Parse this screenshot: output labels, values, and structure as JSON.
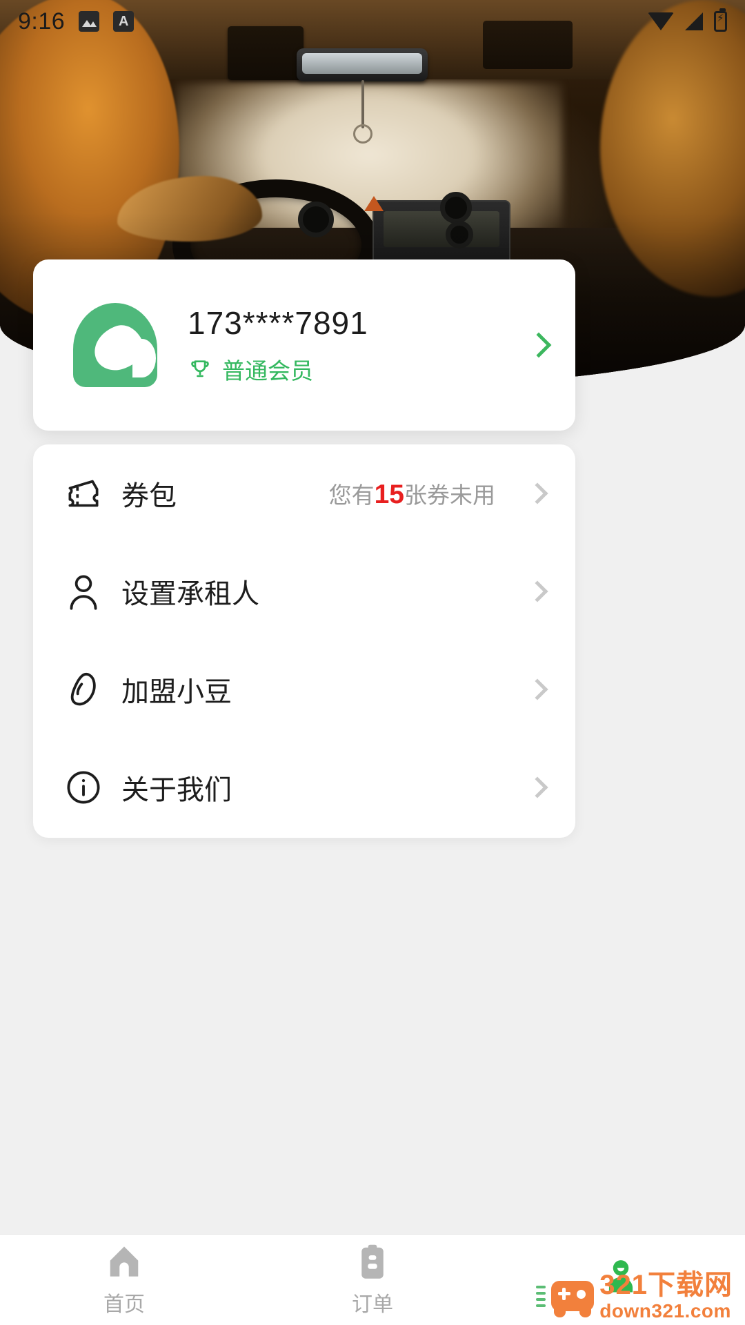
{
  "status_bar": {
    "time": "9:16",
    "left_icons": [
      {
        "name": "gallery-icon",
        "glyph": ""
      },
      {
        "name": "app-a-icon",
        "glyph": "A"
      }
    ],
    "right_icons": [
      {
        "name": "wifi-icon"
      },
      {
        "name": "cellular-signal-icon"
      },
      {
        "name": "battery-charging-icon"
      }
    ]
  },
  "hero": {
    "alt": "car-interior-photo"
  },
  "profile": {
    "avatar_name": "app-logo-avatar",
    "phone_number": "173****7891",
    "member_badge_icon": "trophy-icon",
    "member_level": "普通会员",
    "chevron": "chevron-right-icon"
  },
  "menu": {
    "items": [
      {
        "id": "coupon-pack",
        "icon": "ticket-icon",
        "label": "券包",
        "value_prefix": "您有",
        "value_count": "15",
        "value_suffix": "张券未用"
      },
      {
        "id": "set-lessee",
        "icon": "person-icon",
        "label": "设置承租人",
        "value_prefix": "",
        "value_count": "",
        "value_suffix": ""
      },
      {
        "id": "join-xiaodou",
        "icon": "bean-icon",
        "label": "加盟小豆",
        "value_prefix": "",
        "value_count": "",
        "value_suffix": ""
      },
      {
        "id": "about-us",
        "icon": "info-icon",
        "label": "关于我们",
        "value_prefix": "",
        "value_count": "",
        "value_suffix": ""
      }
    ]
  },
  "bottom_nav": {
    "items": [
      {
        "id": "home",
        "icon": "home-icon",
        "label": "首页",
        "active": false
      },
      {
        "id": "orders",
        "icon": "clipboard-icon",
        "label": "订单",
        "active": false
      },
      {
        "id": "profile",
        "icon": "person-filled-icon",
        "label": "",
        "active": true
      }
    ]
  },
  "watermark": {
    "brand_cn": "321下载网",
    "brand_url": "down321.com",
    "icon": "gamepad-icon"
  },
  "colors": {
    "brand_green": "#4fb87b",
    "accent_green": "#34b85f",
    "nav_active_green": "#2fb84f",
    "alert_red": "#e81f1f",
    "page_bg": "#f0f0f0",
    "card_bg": "#ffffff",
    "muted_text": "#9a9a9a",
    "watermark_orange": "#f2803c"
  }
}
